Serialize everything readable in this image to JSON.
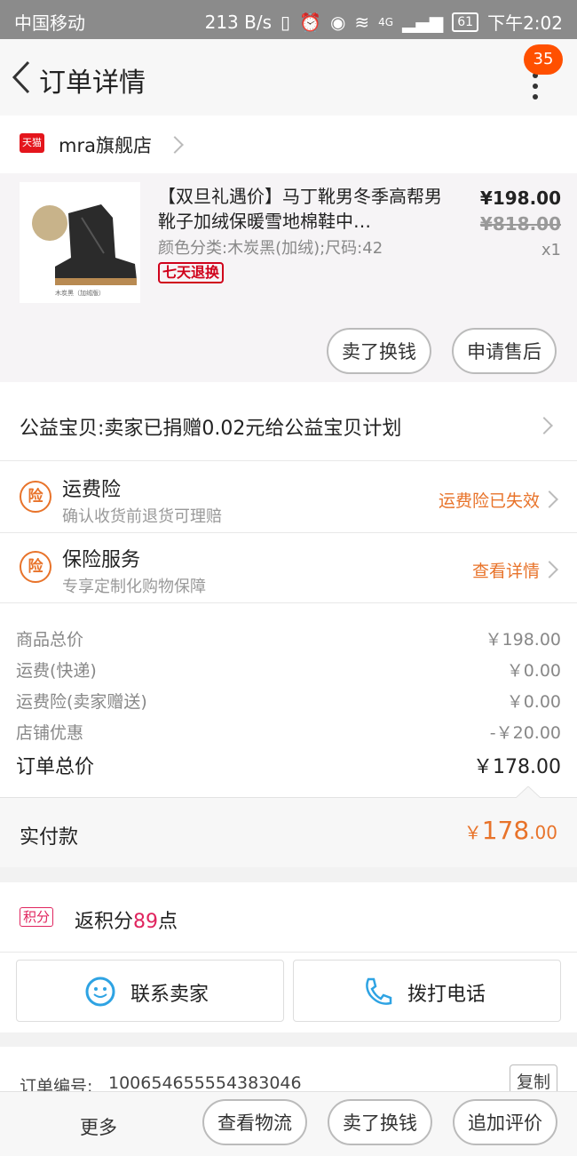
{
  "status_bar": {
    "carrier": "中国移动",
    "speed": "213 B/s",
    "network": "4G",
    "battery": "61",
    "time": "下午2:02"
  },
  "header": {
    "title": "订单详情",
    "badge_count": "35"
  },
  "store": {
    "platform_label": "天猫",
    "name": "mra旗舰店"
  },
  "product": {
    "title": "【双旦礼遇价】马丁靴男冬季高帮男靴子加绒保暖雪地棉鞋中…",
    "sku": "颜色分类:木炭黑(加绒);尺码:42",
    "tag": "七天退换",
    "price": "¥198.00",
    "original_price": "¥818.00",
    "quantity": "x1",
    "image_caption": "木炭黑（加绒版）",
    "actions": [
      "卖了换钱",
      "申请售后"
    ]
  },
  "charity": {
    "text": "公益宝贝:卖家已捐赠0.02元给公益宝贝计划"
  },
  "insurance": [
    {
      "icon": "险",
      "title": "运费险",
      "subtitle": "确认收货前退货可理赔",
      "status": "运费险已失效"
    },
    {
      "icon": "险",
      "title": "保险服务",
      "subtitle": "专享定制化购物保障",
      "status": "查看详情"
    }
  ],
  "fees": [
    {
      "label": "商品总价",
      "value": "￥198.00"
    },
    {
      "label": "运费(快递)",
      "value": "￥0.00"
    },
    {
      "label": "运费险(卖家赠送)",
      "value": "￥0.00"
    },
    {
      "label": "店铺优惠",
      "value": "-￥20.00"
    }
  ],
  "order_total": {
    "label": "订单总价",
    "value": "￥178.00"
  },
  "paid": {
    "label": "实付款",
    "currency": "￥",
    "integer": "178",
    "decimal": ".00"
  },
  "points": {
    "badge": "积分",
    "prefix": "返积分",
    "value": "89",
    "suffix": "点"
  },
  "contact": {
    "seller": "联系卖家",
    "phone": "拨打电话"
  },
  "order_info": {
    "label": "订单编号:",
    "number": "100654655554383046",
    "copy": "复制"
  },
  "bottom_bar": {
    "more": "更多",
    "buttons": [
      "查看物流",
      "卖了换钱",
      "追加评价"
    ]
  },
  "colors": {
    "accent": "#ff5000",
    "orange": "#e8732a",
    "red": "#d0021b",
    "points": "#e0245e"
  }
}
